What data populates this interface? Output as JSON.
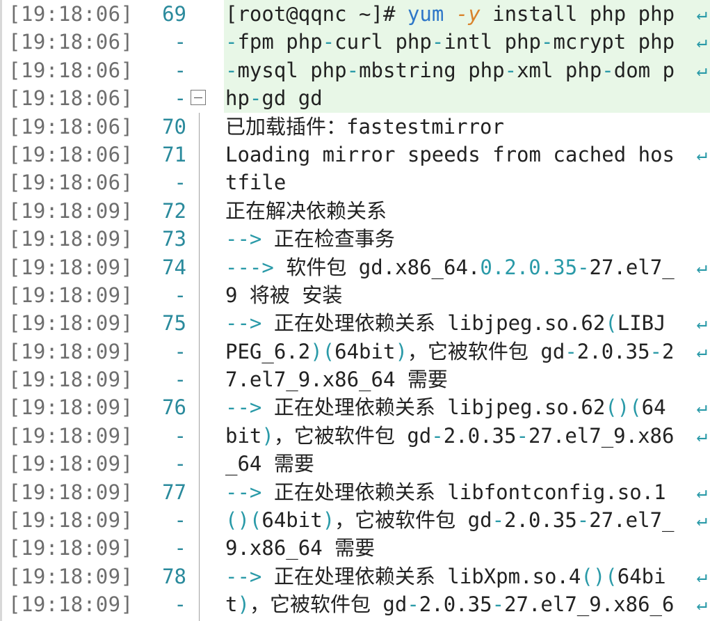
{
  "colors": {
    "default": "#222222",
    "accent": "#2a9aa8",
    "keyword": "#2e77c8",
    "flag": "#d9832b",
    "highlight_bg": "#e8f7e7",
    "timestamp": "#6e6e6e"
  },
  "wrap_glyph": "↵",
  "lines": [
    {
      "ts": "[19:18:06]",
      "ln": "69",
      "hl": true,
      "fold": false,
      "wrap": true,
      "segs": [
        {
          "t": "[root@qqnc ~]# ",
          "c": "default"
        },
        {
          "t": "yum ",
          "c": "keyword"
        },
        {
          "t": "-y ",
          "c": "flag"
        },
        {
          "t": "install php php",
          "c": "default"
        }
      ]
    },
    {
      "ts": "[19:18:06]",
      "ln": "-",
      "hl": true,
      "fold": false,
      "wrap": true,
      "segs": [
        {
          "t": "-",
          "c": "accent"
        },
        {
          "t": "fpm php",
          "c": "default"
        },
        {
          "t": "-",
          "c": "accent"
        },
        {
          "t": "curl php",
          "c": "default"
        },
        {
          "t": "-",
          "c": "accent"
        },
        {
          "t": "intl php",
          "c": "default"
        },
        {
          "t": "-",
          "c": "accent"
        },
        {
          "t": "mcrypt php",
          "c": "default"
        }
      ]
    },
    {
      "ts": "[19:18:06]",
      "ln": "-",
      "hl": true,
      "fold": false,
      "wrap": true,
      "segs": [
        {
          "t": "-",
          "c": "accent"
        },
        {
          "t": "mysql php",
          "c": "default"
        },
        {
          "t": "-",
          "c": "accent"
        },
        {
          "t": "mbstring php",
          "c": "default"
        },
        {
          "t": "-",
          "c": "accent"
        },
        {
          "t": "xml php",
          "c": "default"
        },
        {
          "t": "-",
          "c": "accent"
        },
        {
          "t": "dom p",
          "c": "default"
        }
      ]
    },
    {
      "ts": "[19:18:06]",
      "ln": "-",
      "hl": true,
      "fold": true,
      "wrap": false,
      "segs": [
        {
          "t": "hp",
          "c": "default"
        },
        {
          "t": "-",
          "c": "accent"
        },
        {
          "t": "gd gd",
          "c": "default"
        }
      ]
    },
    {
      "ts": "[19:18:06]",
      "ln": "70",
      "hl": false,
      "fold": false,
      "wrap": false,
      "segs": [
        {
          "t": "已加载插件：fastestmirror",
          "c": "default"
        }
      ]
    },
    {
      "ts": "[19:18:06]",
      "ln": "71",
      "hl": false,
      "fold": false,
      "wrap": true,
      "segs": [
        {
          "t": "Loading mirror speeds from cached hos",
          "c": "default"
        }
      ]
    },
    {
      "ts": "[19:18:06]",
      "ln": "-",
      "hl": false,
      "fold": false,
      "wrap": false,
      "segs": [
        {
          "t": "tfile",
          "c": "default"
        }
      ]
    },
    {
      "ts": "[19:18:09]",
      "ln": "72",
      "hl": false,
      "fold": false,
      "wrap": false,
      "segs": [
        {
          "t": "正在解决依赖关系",
          "c": "default"
        }
      ]
    },
    {
      "ts": "[19:18:09]",
      "ln": "73",
      "hl": false,
      "fold": false,
      "wrap": false,
      "segs": [
        {
          "t": "--> ",
          "c": "accent"
        },
        {
          "t": "正在检查事务",
          "c": "default"
        }
      ]
    },
    {
      "ts": "[19:18:09]",
      "ln": "74",
      "hl": false,
      "fold": false,
      "wrap": true,
      "segs": [
        {
          "t": "---> ",
          "c": "accent"
        },
        {
          "t": "软件包 gd.x86_64.",
          "c": "default"
        },
        {
          "t": "0.2.0.35",
          "c": "accent"
        },
        {
          "t": "-",
          "c": "accent"
        },
        {
          "t": "27.el7_",
          "c": "default"
        }
      ]
    },
    {
      "ts": "[19:18:09]",
      "ln": "-",
      "hl": false,
      "fold": false,
      "wrap": false,
      "segs": [
        {
          "t": "9 将被 安装",
          "c": "default"
        }
      ]
    },
    {
      "ts": "[19:18:09]",
      "ln": "75",
      "hl": false,
      "fold": false,
      "wrap": true,
      "segs": [
        {
          "t": "--> ",
          "c": "accent"
        },
        {
          "t": "正在处理依赖关系 libjpeg.so.62",
          "c": "default"
        },
        {
          "t": "(",
          "c": "accent"
        },
        {
          "t": "LIBJ ",
          "c": "default"
        }
      ]
    },
    {
      "ts": "[19:18:09]",
      "ln": "-",
      "hl": false,
      "fold": false,
      "wrap": true,
      "segs": [
        {
          "t": "PEG_6.2",
          "c": "default"
        },
        {
          "t": ")(",
          "c": "accent"
        },
        {
          "t": "64bit",
          "c": "default"
        },
        {
          "t": ")",
          "c": "accent"
        },
        {
          "t": "，它被软件包 gd",
          "c": "default"
        },
        {
          "t": "-",
          "c": "accent"
        },
        {
          "t": "2.0.35",
          "c": "default"
        },
        {
          "t": "-",
          "c": "accent"
        },
        {
          "t": "2",
          "c": "default"
        }
      ]
    },
    {
      "ts": "[19:18:09]",
      "ln": "-",
      "hl": false,
      "fold": false,
      "wrap": false,
      "segs": [
        {
          "t": "7.el7_9.x86_64 需要",
          "c": "default"
        }
      ]
    },
    {
      "ts": "[19:18:09]",
      "ln": "76",
      "hl": false,
      "fold": false,
      "wrap": true,
      "segs": [
        {
          "t": "--> ",
          "c": "accent"
        },
        {
          "t": "正在处理依赖关系 libjpeg.so.62",
          "c": "default"
        },
        {
          "t": "()(",
          "c": "accent"
        },
        {
          "t": "64 ",
          "c": "default"
        }
      ]
    },
    {
      "ts": "[19:18:09]",
      "ln": "-",
      "hl": false,
      "fold": false,
      "wrap": true,
      "segs": [
        {
          "t": "bit",
          "c": "default"
        },
        {
          "t": ")",
          "c": "accent"
        },
        {
          "t": "，它被软件包 gd",
          "c": "default"
        },
        {
          "t": "-",
          "c": "accent"
        },
        {
          "t": "2.0.35",
          "c": "default"
        },
        {
          "t": "-",
          "c": "accent"
        },
        {
          "t": "27.el7_9.x86",
          "c": "default"
        }
      ]
    },
    {
      "ts": "[19:18:09]",
      "ln": "-",
      "hl": false,
      "fold": false,
      "wrap": false,
      "segs": [
        {
          "t": "_64 需要",
          "c": "default"
        }
      ]
    },
    {
      "ts": "[19:18:09]",
      "ln": "77",
      "hl": false,
      "fold": false,
      "wrap": true,
      "segs": [
        {
          "t": "--> ",
          "c": "accent"
        },
        {
          "t": "正在处理依赖关系 libfontconfig.so.1 ",
          "c": "default"
        }
      ]
    },
    {
      "ts": "[19:18:09]",
      "ln": "-",
      "hl": false,
      "fold": false,
      "wrap": true,
      "segs": [
        {
          "t": "()(",
          "c": "accent"
        },
        {
          "t": "64bit",
          "c": "default"
        },
        {
          "t": ")",
          "c": "accent"
        },
        {
          "t": "，它被软件包 gd",
          "c": "default"
        },
        {
          "t": "-",
          "c": "accent"
        },
        {
          "t": "2.0.35",
          "c": "default"
        },
        {
          "t": "-",
          "c": "accent"
        },
        {
          "t": "27.el7_",
          "c": "default"
        }
      ]
    },
    {
      "ts": "[19:18:09]",
      "ln": "-",
      "hl": false,
      "fold": false,
      "wrap": false,
      "segs": [
        {
          "t": "9.x86_64 需要",
          "c": "default"
        }
      ]
    },
    {
      "ts": "[19:18:09]",
      "ln": "78",
      "hl": false,
      "fold": false,
      "wrap": true,
      "segs": [
        {
          "t": "--> ",
          "c": "accent"
        },
        {
          "t": "正在处理依赖关系 libXpm.so.4",
          "c": "default"
        },
        {
          "t": "()(",
          "c": "accent"
        },
        {
          "t": "64bi ",
          "c": "default"
        }
      ]
    },
    {
      "ts": "[19:18:09]",
      "ln": "-",
      "hl": false,
      "fold": false,
      "wrap": true,
      "segs": [
        {
          "t": "t",
          "c": "default"
        },
        {
          "t": ")",
          "c": "accent"
        },
        {
          "t": "，它被软件包 gd",
          "c": "default"
        },
        {
          "t": "-",
          "c": "accent"
        },
        {
          "t": "2.0.35",
          "c": "default"
        },
        {
          "t": "-",
          "c": "accent"
        },
        {
          "t": "27.el7_9.x86_6",
          "c": "default"
        }
      ]
    }
  ]
}
